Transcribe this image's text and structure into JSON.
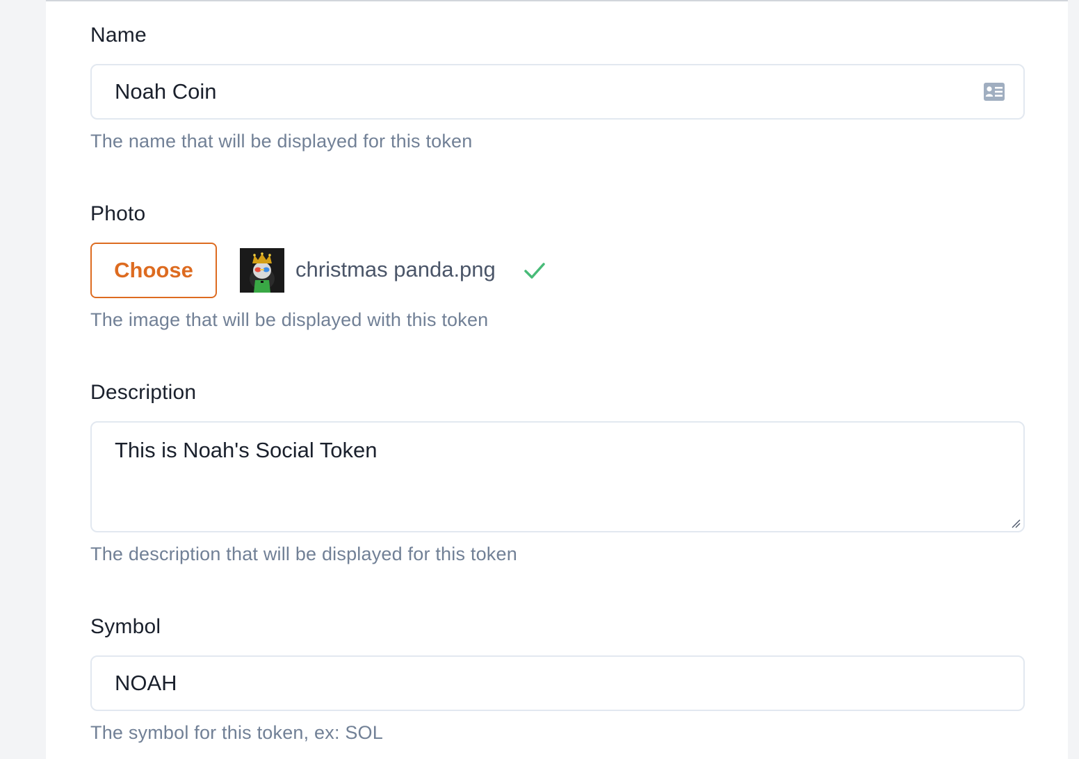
{
  "form": {
    "name": {
      "label": "Name",
      "value": "Noah Coin",
      "helper": "The name that will be displayed for this token",
      "icon": "contact-card-icon"
    },
    "photo": {
      "label": "Photo",
      "button_label": "Choose",
      "file_name": "christmas panda.png",
      "status_icon": "check-icon",
      "helper": "The image that will be displayed with this token"
    },
    "description": {
      "label": "Description",
      "value": "This is Noah's Social Token",
      "helper": "The description that will be displayed for this token"
    },
    "symbol": {
      "label": "Symbol",
      "value": "NOAH",
      "helper": "The symbol for this token, ex: SOL"
    }
  },
  "colors": {
    "accent": "#dd6b20",
    "success": "#48bb78",
    "helper_text": "#718096",
    "border": "#e2e8f0"
  }
}
